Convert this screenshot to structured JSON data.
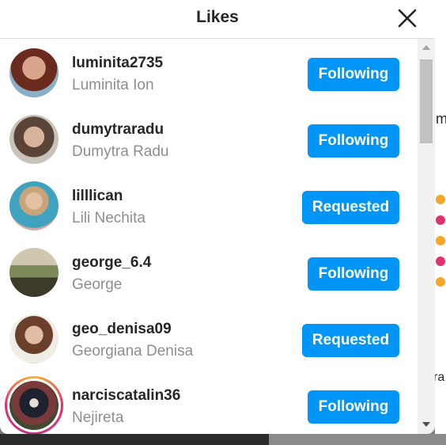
{
  "modal": {
    "title": "Likes",
    "close_icon": "close-icon"
  },
  "likes": [
    {
      "username": "luminita2735",
      "full_name": "Luminita Ion",
      "button": "Following",
      "status": "following",
      "avatar_color": "#8a3b2f"
    },
    {
      "username": "dumytraradu",
      "full_name": "Dumytra Radu",
      "button": "Following",
      "status": "following",
      "avatar_color": "#b89a86"
    },
    {
      "username": "lilllican",
      "full_name": "Lili Nechita",
      "button": "Requested",
      "status": "requested",
      "avatar_color": "#5aa0b8"
    },
    {
      "username": "george_6.4",
      "full_name": "George",
      "button": "Following",
      "status": "following",
      "avatar_color": "#6a7a52"
    },
    {
      "username": "geo_denisa09",
      "full_name": "Georgiana Denisa",
      "button": "Requested",
      "status": "requested",
      "avatar_color": "#9a6d5a"
    },
    {
      "username": "narciscatalin36",
      "full_name": "Nejireta",
      "button": "Following",
      "status": "following",
      "avatar_color": "#3f4a30",
      "has_story": true
    }
  ],
  "background": {
    "text_m": "m",
    "text_ra": "ra"
  },
  "colors": {
    "button_blue": "#0095f6",
    "username": "#262626",
    "fullname": "#8e8e8e"
  }
}
